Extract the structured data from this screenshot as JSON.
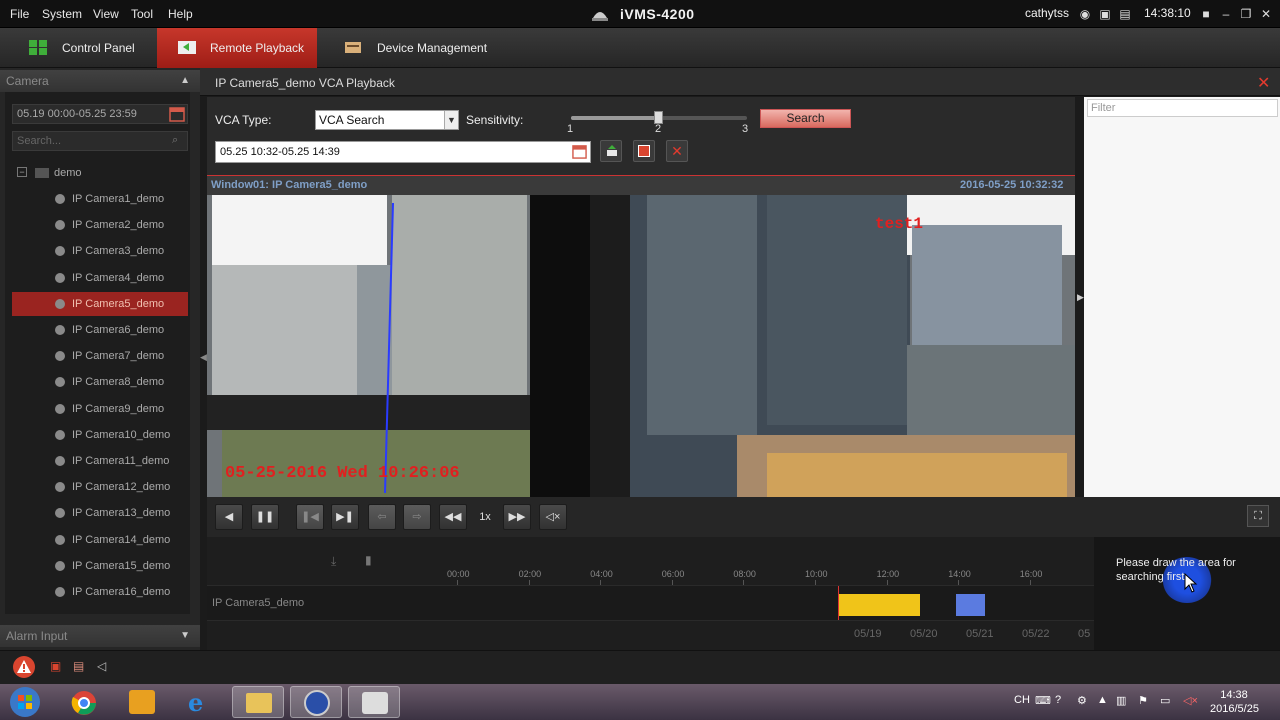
{
  "menu": [
    "File",
    "System",
    "View",
    "Tool",
    "Help"
  ],
  "app_title": "iVMS-4200",
  "user": "cathytss",
  "time": "14:38:10",
  "tabs": {
    "control_panel": "Control Panel",
    "remote_playback": "Remote Playback",
    "device_management": "Device Management"
  },
  "left": {
    "camera_header": "Camera",
    "date_range": "05.19 00:00-05.25 23:59",
    "search_placeholder": "Search...",
    "group": "demo",
    "cameras": [
      "IP Camera1_demo",
      "IP Camera2_demo",
      "IP Camera3_demo",
      "IP Camera4_demo",
      "IP Camera5_demo",
      "IP Camera6_demo",
      "IP Camera7_demo",
      "IP Camera8_demo",
      "IP Camera9_demo",
      "IP Camera10_demo",
      "IP Camera11_demo",
      "IP Camera12_demo",
      "IP Camera13_demo",
      "IP Camera14_demo",
      "IP Camera15_demo",
      "IP Camera16_demo"
    ],
    "selected_index": 4,
    "alarm_header": "Alarm Input"
  },
  "main": {
    "title": "IP Camera5_demo VCA Playback",
    "vca_label": "VCA Type:",
    "vca_value": "VCA Search",
    "sensitivity_label": "Sensitivity:",
    "sensitivity_ticks": [
      "1",
      "2",
      "3"
    ],
    "sensitivity_value": 2,
    "search_label": "Search",
    "time_range": "05.25 10:32-05.25 14:39",
    "window_label": "Window01: IP Camera5_demo",
    "window_time": "2016-05-25 10:32:32",
    "osd_time": "05-25-2016 Wed 10:26:06",
    "osd_name": "test1",
    "filter_placeholder": "Filter",
    "speed": "1x"
  },
  "timeline": {
    "hours": [
      "00:00",
      "02:00",
      "04:00",
      "06:00",
      "08:00",
      "10:00",
      "12:00",
      "14:00",
      "16:00"
    ],
    "camera": "IP Camera5_demo",
    "dates": [
      "05/19",
      "05/20",
      "05/21",
      "05/22",
      "05"
    ],
    "hint": "Please draw the area for searching first."
  },
  "taskbar": {
    "clock_time": "14:38",
    "clock_date": "2016/5/25",
    "lang": "CH"
  },
  "colors": {
    "accent": "#b3261e",
    "record_normal": "#f0c419",
    "record_vca": "#5b7be0"
  }
}
